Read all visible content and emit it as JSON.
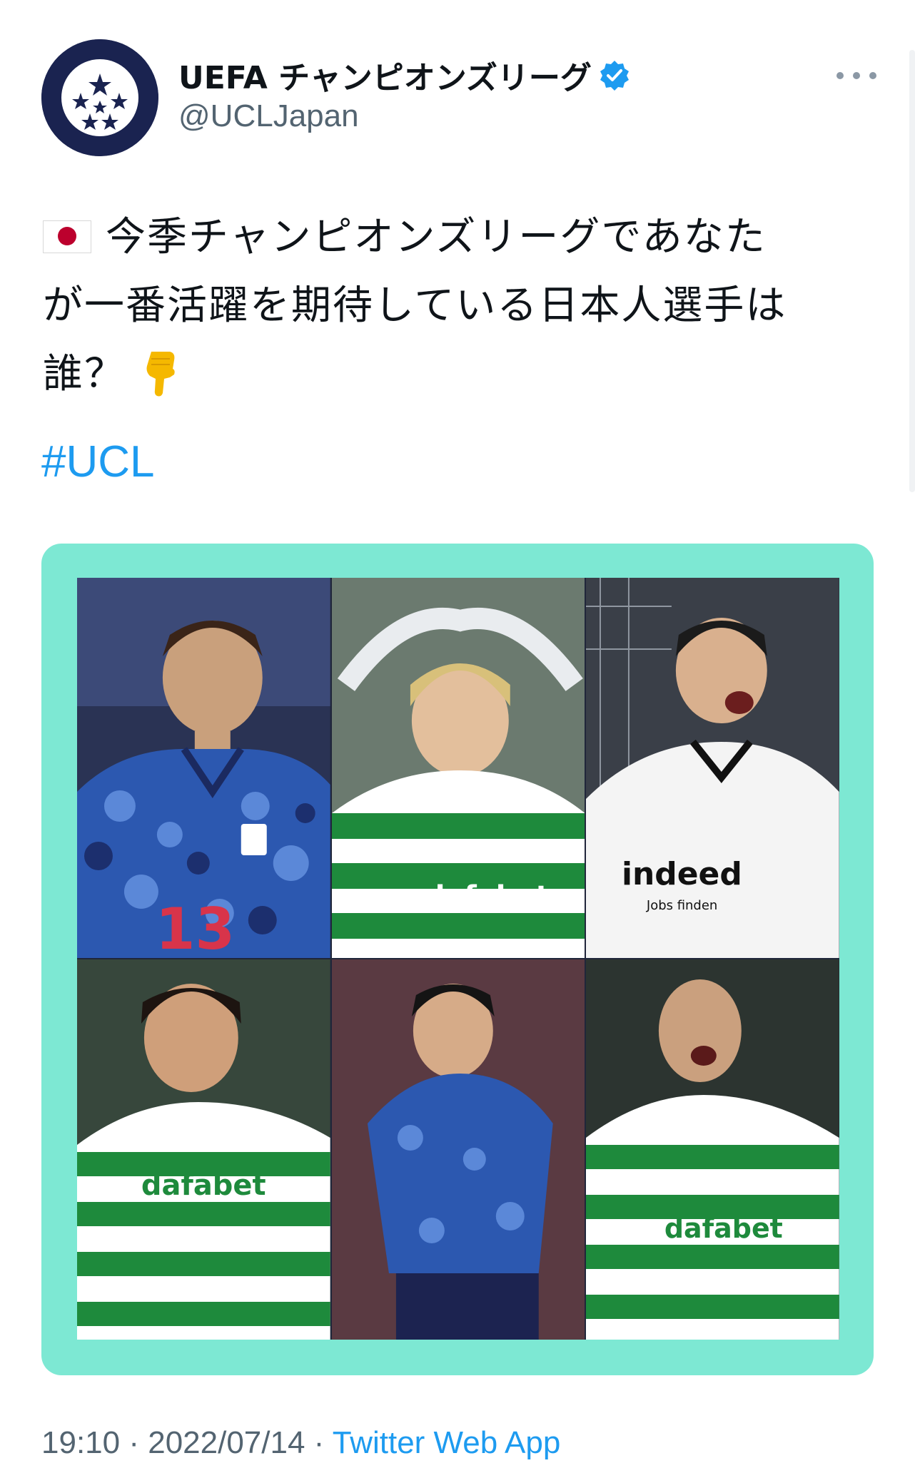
{
  "author": {
    "display_name": "UEFA チャンピオンズリーグ",
    "handle": "@UCLJapan",
    "verified": true,
    "avatar_icon": "starball-logo-icon"
  },
  "tweet": {
    "text_line1": "今季チャンピオンズリーグであなた",
    "text_line2": "が一番活躍を期待している日本人選手は",
    "text_line3": "誰？",
    "flag_emoji": "🇯🇵",
    "point_emoji": "👇",
    "hashtag": "#UCL"
  },
  "media": {
    "border_color": "#7de8d3",
    "photos": [
      {
        "kit": "japan-blue-camo",
        "number": "13",
        "label": "player-photo-1"
      },
      {
        "kit": "celtic-hoops",
        "sponsor": "dafabet",
        "label": "player-photo-2"
      },
      {
        "kit": "frankfurt-white",
        "sponsor": "indeed",
        "sponsor_sub": "Jobs finden",
        "label": "player-photo-3"
      },
      {
        "kit": "celtic-hoops",
        "sponsor": "dafabet",
        "label": "player-photo-4"
      },
      {
        "kit": "japan-blue-camo",
        "label": "player-photo-5"
      },
      {
        "kit": "celtic-hoops",
        "sponsor": "dafabet",
        "label": "player-photo-6"
      }
    ]
  },
  "footer": {
    "time": "19:10",
    "separator1": " · ",
    "date": "2022/07/14",
    "separator2": " · ",
    "source": "Twitter Web App"
  },
  "colors": {
    "link": "#1d9bf0",
    "secondary_text": "#536471",
    "avatar_bg": "#1a2350"
  }
}
